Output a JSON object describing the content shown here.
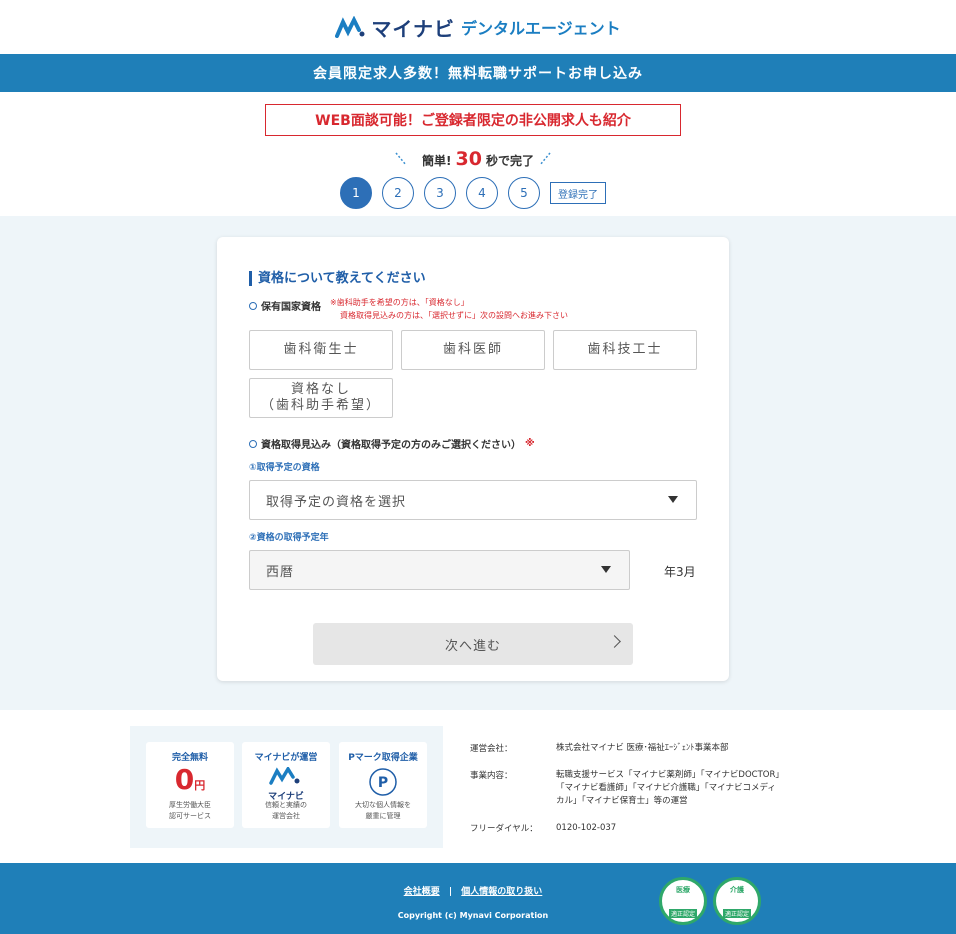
{
  "header": {
    "brand": "マイナビ",
    "sub": "デンタルエージェント"
  },
  "banner": "会員限定求人多数！無料転職サポートお申し込み",
  "notice": "WEB面談可能！ご登録者限定の非公開求人も紹介",
  "easy": {
    "pre": "簡単!",
    "num": "30",
    "post": "秒で完了"
  },
  "steps": {
    "items": [
      "1",
      "2",
      "3",
      "4",
      "5"
    ],
    "done": "登録完了",
    "current": 1
  },
  "form": {
    "title": "資格について教えてください",
    "q1": {
      "label": "保有国家資格",
      "note1": "※歯科助手を希望の方は、「資格なし」",
      "note2": "資格取得見込みの方は、「選択せずに」次の設問へお進み下さい"
    },
    "options": [
      "歯科衛生士",
      "歯科医師",
      "歯科技工士",
      "資格なし",
      "（歯科助手希望）"
    ],
    "q2": {
      "label": "資格取得見込み（資格取得予定の方のみご選択ください）",
      "mark": "※"
    },
    "sub1": "①取得予定の資格",
    "select1": "取得予定の資格を選択",
    "sub2": "②資格の取得予定年",
    "select2": "西暦",
    "year_suffix": "年3月",
    "next": "次へ進む"
  },
  "badges": [
    {
      "title": "完全無料",
      "zero": "0",
      "yen": "円",
      "desc1": "厚生労働大臣",
      "desc2": "認可サービス"
    },
    {
      "title": "マイナビが運営",
      "logo": "マイナビ",
      "desc1": "信頼と実績の",
      "desc2": "運営会社"
    },
    {
      "title": "Pマーク取得企業",
      "desc1": "大切な個人情報を",
      "desc2": "厳重に管理"
    }
  ],
  "company": {
    "k1": "運営会社：",
    "v1": "株式会社マイナビ 医療･福祉ｴｰｼﾞｪﾝﾄ事業本部",
    "k2": "事業内容：",
    "v2a": "転職支援サービス「マイナビ薬剤師」「マイナビDOCTOR」",
    "v2b": "「マイナビ看護師」「マイナビ介護職」「マイナビコメディ",
    "v2c": "カル」「マイナビ保育士」等の運営",
    "k3": "フリーダイヤル：",
    "v3": "0120-102-037"
  },
  "footer": {
    "link1": "会社概要",
    "sep": "|",
    "link2": "個人情報の取り扱い",
    "copyright": "Copyright (c) Mynavi Corporation"
  },
  "seals": [
    {
      "top": "医療",
      "bottom": "適正認定"
    },
    {
      "top": "介護",
      "bottom": "適正認定"
    }
  ],
  "colors": {
    "primary": "#1f7fb8",
    "accent": "#d8282f",
    "bg": "#eef5f9"
  }
}
